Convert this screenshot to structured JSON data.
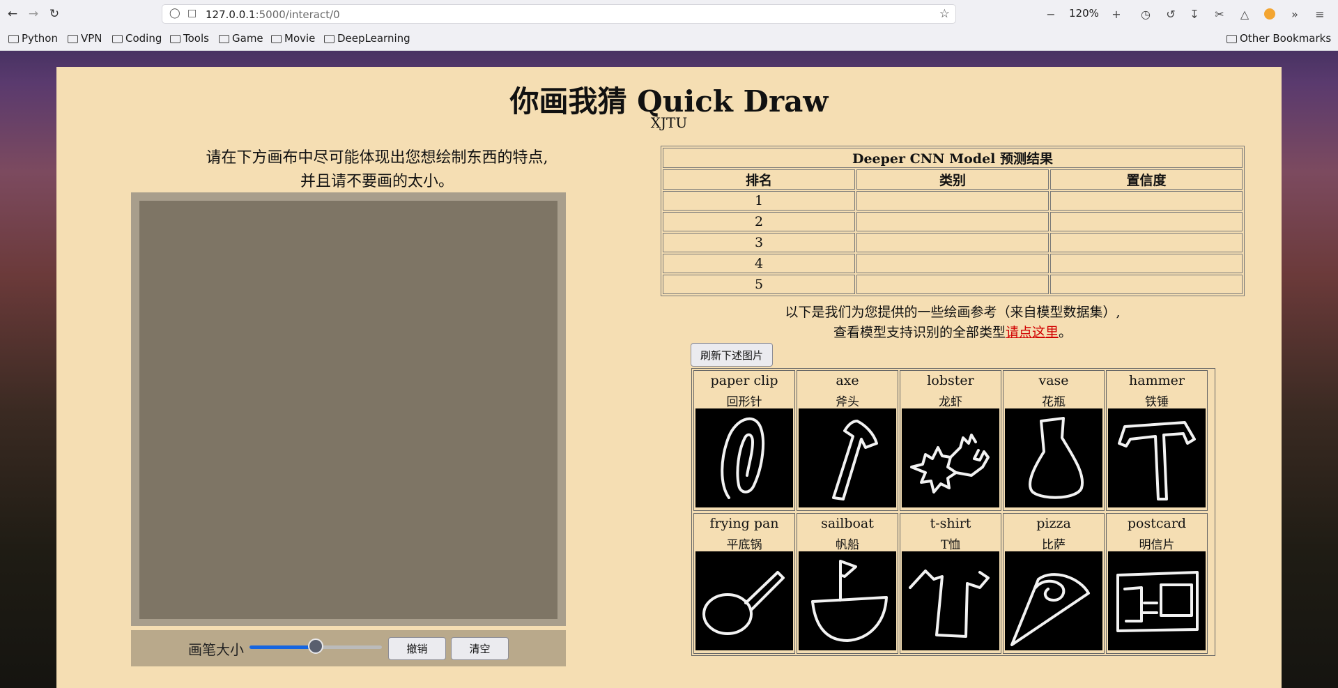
{
  "browser": {
    "url_host": "127.0.0.1",
    "url_path": ":5000/interact/0",
    "zoom": "120%",
    "bookmarks": [
      "Python",
      "VPN",
      "Coding",
      "Tools",
      "Game",
      "Movie",
      "DeepLearning"
    ],
    "other_bookmarks": "Other Bookmarks"
  },
  "page": {
    "title": "你画我猜 Quick Draw",
    "subtitle": "XJTU",
    "instruction_line1": "请在下方画布中尽可能体现出您想绘制东西的特点,",
    "instruction_line2": "并且请不要画的太小。"
  },
  "controls": {
    "brush_label": "画笔大小",
    "brush_size_fraction": 0.5,
    "undo_label": "撤销",
    "clear_label": "清空"
  },
  "results": {
    "caption": "Deeper CNN Model 预测结果",
    "headers": [
      "排名",
      "类别",
      "置信度"
    ],
    "rows": [
      {
        "rank": "1",
        "category": "",
        "confidence": ""
      },
      {
        "rank": "2",
        "category": "",
        "confidence": ""
      },
      {
        "rank": "3",
        "category": "",
        "confidence": ""
      },
      {
        "rank": "4",
        "category": "",
        "confidence": ""
      },
      {
        "rank": "5",
        "category": "",
        "confidence": ""
      }
    ]
  },
  "reference": {
    "line1": "以下是我们为您提供的一些绘画参考（来自模型数据集）,",
    "line2_prefix": "查看模型支持识别的全部类型",
    "link_text": "请点这里",
    "line2_suffix": "。",
    "refresh_label": "刷新下述图片",
    "items": [
      {
        "en": "paper clip",
        "cn": "回形针",
        "icon": "paper-clip"
      },
      {
        "en": "axe",
        "cn": "斧头",
        "icon": "axe"
      },
      {
        "en": "lobster",
        "cn": "龙虾",
        "icon": "lobster"
      },
      {
        "en": "vase",
        "cn": "花瓶",
        "icon": "vase"
      },
      {
        "en": "hammer",
        "cn": "铁锤",
        "icon": "hammer"
      },
      {
        "en": "frying pan",
        "cn": "平底锅",
        "icon": "frying-pan"
      },
      {
        "en": "sailboat",
        "cn": "帆船",
        "icon": "sailboat"
      },
      {
        "en": "t-shirt",
        "cn": "T恤",
        "icon": "t-shirt"
      },
      {
        "en": "pizza",
        "cn": "比萨",
        "icon": "pizza"
      },
      {
        "en": "postcard",
        "cn": "明信片",
        "icon": "postcard"
      }
    ]
  }
}
